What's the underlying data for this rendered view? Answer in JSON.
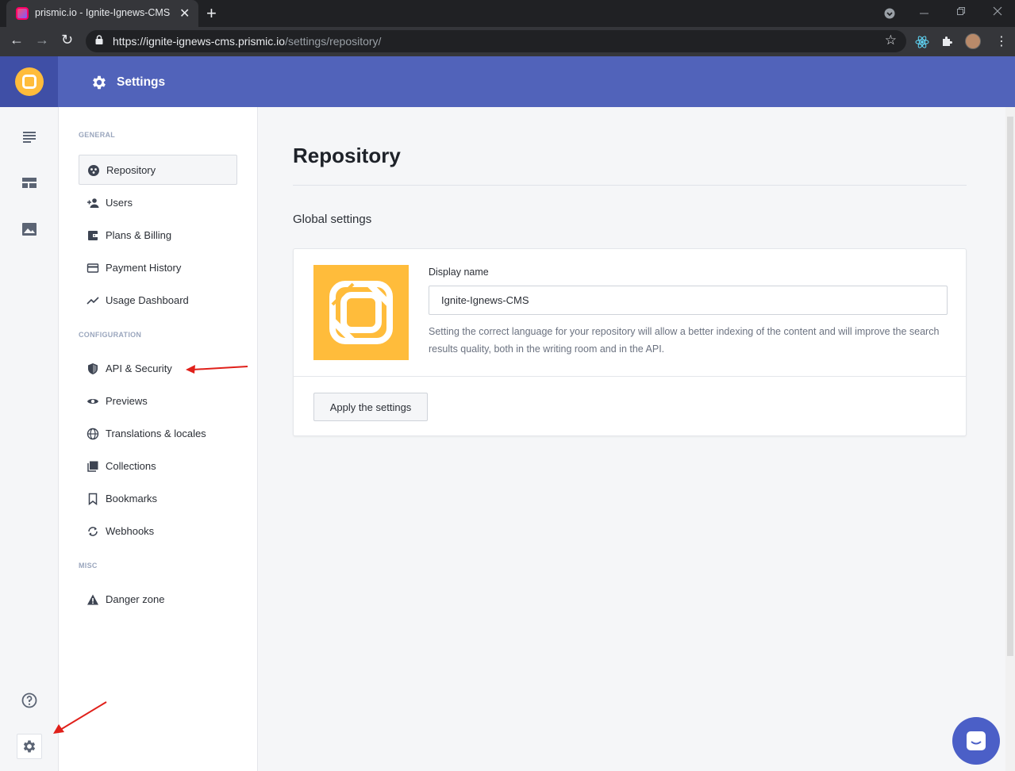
{
  "browser": {
    "tab_title": "prismic.io - Ignite-Ignews-CMS",
    "tab_close": "✕",
    "new_tab": "+",
    "url_host": "https://ignite-ignews-cms.prismic.io",
    "url_path": "/settings/repository/",
    "back": "←",
    "forward": "→",
    "reload": "↻",
    "star": "☆",
    "menu": "⋮"
  },
  "header": {
    "title": "Settings"
  },
  "settings_nav": {
    "sections": {
      "general": "GENERAL",
      "configuration": "CONFIGURATION",
      "misc": "MISC"
    },
    "items": [
      {
        "label": "Repository",
        "icon": "repository-icon",
        "active": true
      },
      {
        "label": "Users",
        "icon": "add-user-icon"
      },
      {
        "label": "Plans & Billing",
        "icon": "wallet-icon"
      },
      {
        "label": "Payment History",
        "icon": "credit-card-icon"
      },
      {
        "label": "Usage Dashboard",
        "icon": "trend-line-icon"
      },
      {
        "label": "API & Security",
        "icon": "shield-icon"
      },
      {
        "label": "Previews",
        "icon": "eye-icon"
      },
      {
        "label": "Translations & locales",
        "icon": "globe-icon"
      },
      {
        "label": "Collections",
        "icon": "collections-icon"
      },
      {
        "label": "Bookmarks",
        "icon": "bookmark-icon"
      },
      {
        "label": "Webhooks",
        "icon": "sync-icon"
      },
      {
        "label": "Danger zone",
        "icon": "warning-icon"
      }
    ]
  },
  "main": {
    "page_title": "Repository",
    "section_title": "Global settings",
    "display_name_label": "Display name",
    "display_name_value": "Ignite-Ignews-CMS",
    "help_text": "Setting the correct language for your repository will allow a better indexing of the content and will improve the search results quality, both in the writing room and in the API.",
    "apply_button": "Apply the settings"
  },
  "colors": {
    "header_bg": "#5163ba",
    "logo_yellow": "#ffbc3b",
    "annotation_red": "#e0201a"
  }
}
